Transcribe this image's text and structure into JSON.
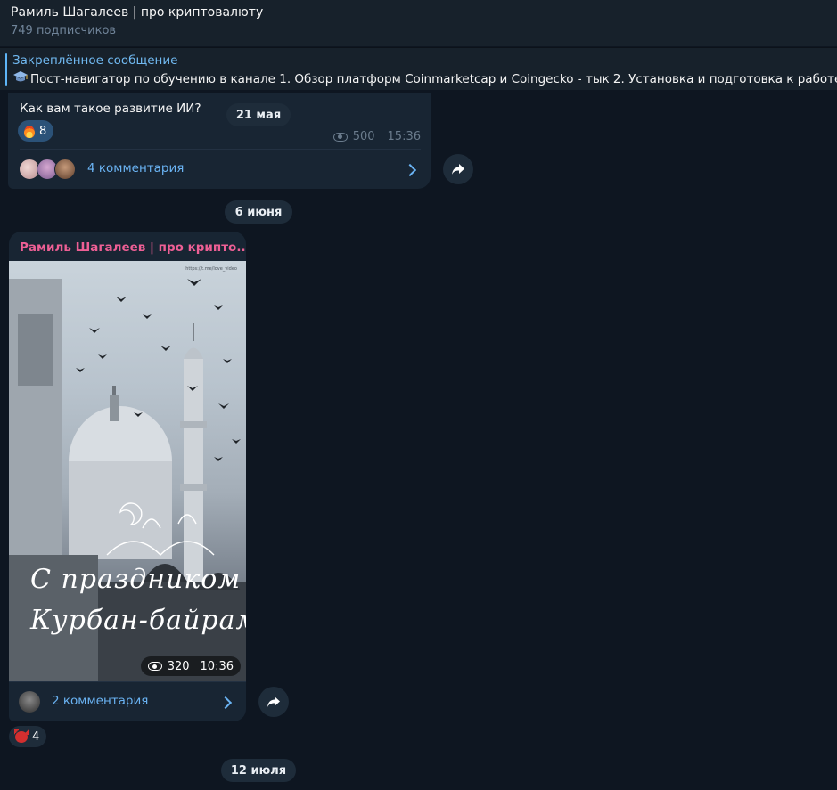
{
  "header": {
    "title": "Рамиль Шагалеев | про криптовалюту",
    "subscribers": "749 подписчиков"
  },
  "pinned": {
    "title": "Закреплённое сообщение",
    "text": "Пост-навигатор по обучению в канале  1. Обзор платформ Coinmarketcap и Coingecko - тык  2. Установка и подготовка к работе криптокошелька",
    "icon": "graduation-cap-icon"
  },
  "post1": {
    "text": "Как вам такое развитие ИИ?",
    "reaction_emoji": "fire",
    "reaction_count": "8",
    "views": "500",
    "time": "15:36",
    "comments_label": "4 комментария"
  },
  "dates": {
    "d1": "21 мая",
    "d2": "6 июня",
    "d3": "12 июля"
  },
  "post2": {
    "author": "Рамиль Шагалеев | про крипто...",
    "photo_watermark": "https://t.me/love_video",
    "greeting_line1": "С праздником",
    "greeting_line2": "Курбан-байрам",
    "views": "320",
    "time": "10:36",
    "comments_label": "2 комментария",
    "reaction_emoji": "devil",
    "reaction_count": "4"
  },
  "colors": {
    "background": "#0e1621",
    "header": "#17212b",
    "bubble": "#182533",
    "accent": "#6ab3f3",
    "author": "#ee5f95",
    "reaction": "#2b5278"
  }
}
